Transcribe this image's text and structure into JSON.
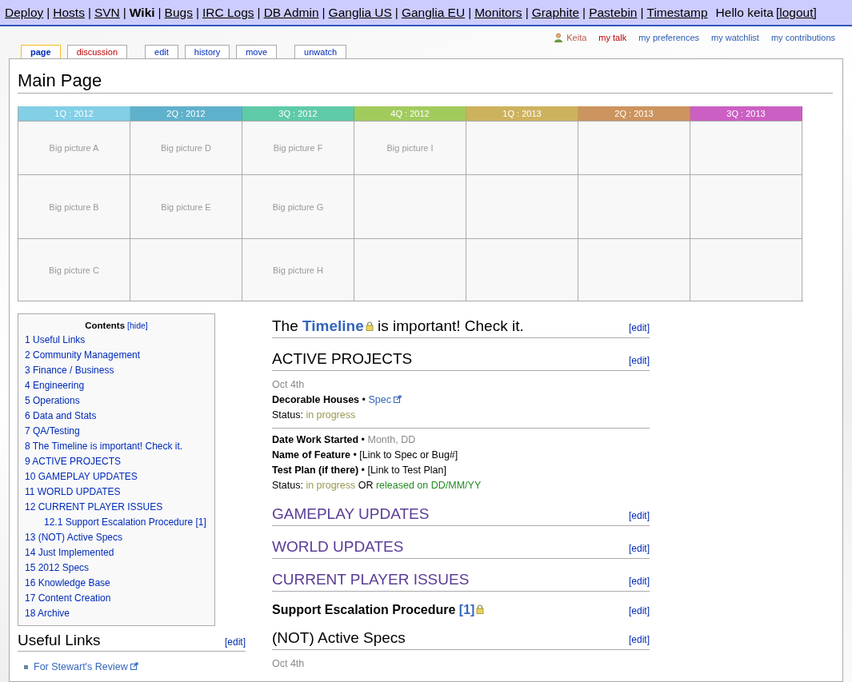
{
  "top_nav": {
    "separator": "|",
    "items": [
      {
        "label": "Deploy",
        "selected": false
      },
      {
        "label": "Hosts",
        "selected": false
      },
      {
        "label": "SVN",
        "selected": false
      },
      {
        "label": "Wiki",
        "selected": true
      },
      {
        "label": "Bugs",
        "selected": false
      },
      {
        "label": "IRC Logs",
        "selected": false
      },
      {
        "label": "DB Admin",
        "selected": false
      },
      {
        "label": "Ganglia US",
        "selected": false
      },
      {
        "label": "Ganglia EU",
        "selected": false
      },
      {
        "label": "Monitors",
        "selected": false
      },
      {
        "label": "Graphite",
        "selected": false
      },
      {
        "label": "Pastebin",
        "selected": false
      },
      {
        "label": "Timestamp",
        "selected": false
      }
    ],
    "greeting": "Hello keita",
    "logout": "[logout]"
  },
  "personal_links": [
    {
      "label": "Keita",
      "kind": "user",
      "color": "#b65a4a"
    },
    {
      "label": "my talk",
      "kind": "link",
      "color": "#ba0000"
    },
    {
      "label": "my preferences",
      "kind": "link",
      "color": "#2a5db0"
    },
    {
      "label": "my watchlist",
      "kind": "link",
      "color": "#2a5db0"
    },
    {
      "label": "my contributions",
      "kind": "link",
      "color": "#2a5db0"
    }
  ],
  "tab_groups": [
    {
      "tabs": [
        {
          "label": "page",
          "selected": true,
          "missing": false
        },
        {
          "label": "discussion",
          "selected": false,
          "missing": true
        }
      ]
    },
    {
      "tabs": [
        {
          "label": "edit",
          "selected": false,
          "missing": false
        },
        {
          "label": "history",
          "selected": false,
          "missing": false
        },
        {
          "label": "move",
          "selected": false,
          "missing": false
        }
      ]
    },
    {
      "tabs": [
        {
          "label": "unwatch",
          "selected": false,
          "missing": false
        }
      ]
    }
  ],
  "page_title": "Main Page",
  "timeline": {
    "columns": [
      {
        "label": "1Q : 2012",
        "color": "#82cfe6",
        "cells": [
          "Big picture A",
          "Big picture B",
          "Big picture C"
        ]
      },
      {
        "label": "2Q : 2012",
        "color": "#5fb1cb",
        "cells": [
          "Big picture D",
          "Big picture E"
        ]
      },
      {
        "label": "3Q : 2012",
        "color": "#5fcaa8",
        "cells": [
          "Big picture F",
          "Big picture G",
          "Big picture H"
        ]
      },
      {
        "label": "4Q : 2012",
        "color": "#a2cb5e",
        "cells": [
          "Big picture I"
        ]
      },
      {
        "label": "1Q : 2013",
        "color": "#cdb25e"
      },
      {
        "label": "2Q : 2013",
        "color": "#cc945e"
      },
      {
        "label": "3Q : 2013",
        "color": "#cb5fc3"
      }
    ]
  },
  "toc": {
    "title": "Contents",
    "toggle": "[hide]",
    "items": [
      {
        "number": "1",
        "label": "Useful Links"
      },
      {
        "number": "2",
        "label": "Community Management"
      },
      {
        "number": "3",
        "label": "Finance / Business"
      },
      {
        "number": "4",
        "label": "Engineering"
      },
      {
        "number": "5",
        "label": "Operations"
      },
      {
        "number": "6",
        "label": "Data and Stats"
      },
      {
        "number": "7",
        "label": "QA/Testing"
      },
      {
        "number": "8",
        "label": "The Timeline is important! Check it."
      },
      {
        "number": "9",
        "label": "ACTIVE PROJECTS"
      },
      {
        "number": "10",
        "label": "GAMEPLAY UPDATES"
      },
      {
        "number": "11",
        "label": "WORLD UPDATES"
      },
      {
        "number": "12",
        "label": "CURRENT PLAYER ISSUES",
        "children": [
          {
            "number": "12.1",
            "label": "Support Escalation Procedure [1]"
          }
        ]
      },
      {
        "number": "13",
        "label": "(NOT) Active Specs"
      },
      {
        "number": "14",
        "label": "Just Implemented"
      },
      {
        "number": "15",
        "label": "2012 Specs"
      },
      {
        "number": "16",
        "label": "Knowledge Base"
      },
      {
        "number": "17",
        "label": "Content Creation"
      },
      {
        "number": "18",
        "label": "Archive"
      }
    ]
  },
  "left_sections": [
    {
      "title": "Useful Links",
      "edit": "[edit]",
      "links": [
        {
          "label": "For Stewart's Review",
          "external": true
        }
      ]
    }
  ],
  "main_blocks": [
    {
      "kind": "h2",
      "color": "#000000",
      "edit": "[edit]",
      "parts": [
        {
          "text": "The ",
          "kind": "plain"
        },
        {
          "text": "Timeline",
          "kind": "link",
          "lock": true
        },
        {
          "text": " is important! Check it.",
          "kind": "plain"
        }
      ]
    },
    {
      "kind": "h2",
      "color": "#000000",
      "edit": "[edit]",
      "parts": [
        {
          "text": "ACTIVE PROJECTS",
          "kind": "plain"
        }
      ]
    },
    {
      "kind": "line",
      "parts": [
        {
          "text": "Oct 4th",
          "kind": "muted"
        }
      ]
    },
    {
      "kind": "line",
      "parts": [
        {
          "text": "Decorable Houses",
          "kind": "bold"
        },
        {
          "text": " • ",
          "kind": "plain"
        },
        {
          "text": "Spec",
          "kind": "link",
          "external": true
        }
      ]
    },
    {
      "kind": "line",
      "parts": [
        {
          "text": "Status: ",
          "kind": "plain"
        },
        {
          "text": "in progress",
          "kind": "progress"
        }
      ]
    },
    {
      "kind": "rule"
    },
    {
      "kind": "line",
      "parts": [
        {
          "text": "Date Work Started",
          "kind": "bold"
        },
        {
          "text": " • ",
          "kind": "plain"
        },
        {
          "text": "Month, DD",
          "kind": "muted"
        }
      ]
    },
    {
      "kind": "line",
      "parts": [
        {
          "text": "Name of Feature",
          "kind": "bold"
        },
        {
          "text": " • [Link to Spec or Bug#]",
          "kind": "plain"
        }
      ]
    },
    {
      "kind": "line",
      "parts": [
        {
          "text": "Test Plan (if there)",
          "kind": "bold"
        },
        {
          "text": " • [Link to Test Plan]",
          "kind": "plain"
        }
      ]
    },
    {
      "kind": "line",
      "parts": [
        {
          "text": "Status: ",
          "kind": "plain"
        },
        {
          "text": "in progress",
          "kind": "progress"
        },
        {
          "text": " OR ",
          "kind": "plain"
        },
        {
          "text": "released on DD/MM/YY",
          "kind": "released"
        }
      ]
    },
    {
      "kind": "h2",
      "color": "#5a3c96",
      "edit": "[edit]",
      "parts": [
        {
          "text": "GAMEPLAY UPDATES",
          "kind": "plain"
        }
      ]
    },
    {
      "kind": "h2",
      "color": "#5a3c96",
      "edit": "[edit]",
      "parts": [
        {
          "text": "WORLD UPDATES",
          "kind": "plain"
        }
      ]
    },
    {
      "kind": "h2",
      "color": "#5a3c96",
      "edit": "[edit]",
      "parts": [
        {
          "text": "CURRENT PLAYER ISSUES",
          "kind": "plain"
        }
      ]
    },
    {
      "kind": "h3",
      "color": "#000000",
      "edit": "[edit]",
      "parts": [
        {
          "text": "Support Escalation Procedure ",
          "kind": "plain"
        },
        {
          "text": "[1]",
          "kind": "link",
          "lock": true
        }
      ]
    },
    {
      "kind": "h2",
      "color": "#000000",
      "edit": "[edit]",
      "parts": [
        {
          "text": "(NOT) Active Specs",
          "kind": "plain"
        }
      ]
    },
    {
      "kind": "line",
      "parts": [
        {
          "text": "Oct 4th",
          "kind": "muted"
        }
      ]
    }
  ]
}
